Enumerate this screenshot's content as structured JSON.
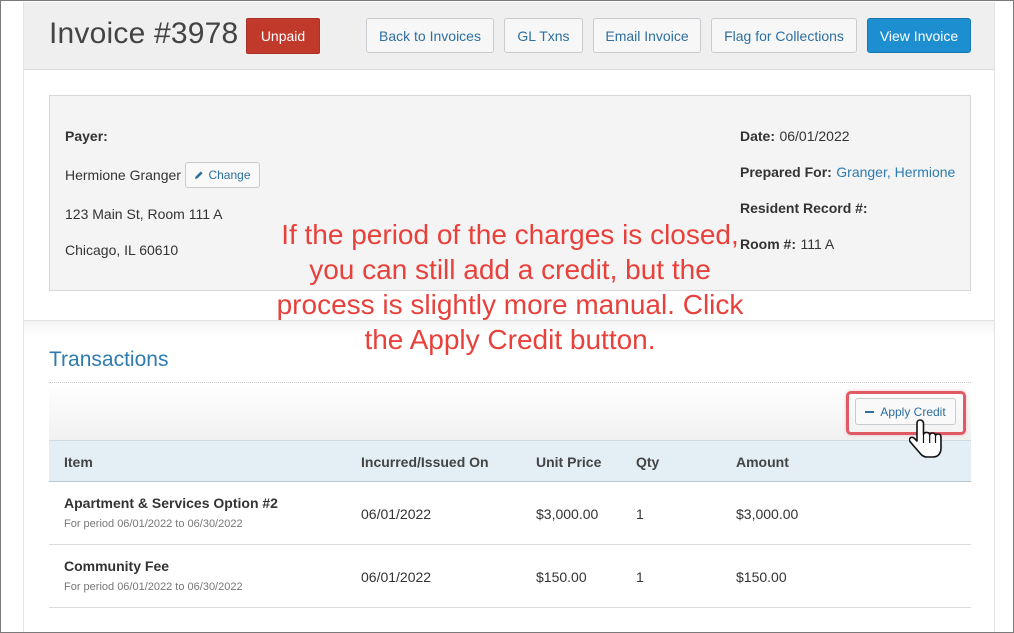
{
  "header": {
    "title": "Invoice #3978",
    "status_badge": "Unpaid",
    "buttons": [
      "Back to Invoices",
      "GL Txns",
      "Email Invoice",
      "Flag for Collections",
      "View Invoice"
    ]
  },
  "info": {
    "payer_label": "Payer:",
    "payer_name": "Hermione Granger",
    "change_label": "Change",
    "address_line1": "123 Main St, Room 111 A",
    "address_line2": "Chicago, IL 60610",
    "date_label": "Date:",
    "date_value": "06/01/2022",
    "prepared_label": "Prepared For:",
    "prepared_value": "Granger, Hermione",
    "resident_label": "Resident Record #:",
    "room_label": "Room #:",
    "room_value": "111 A"
  },
  "annotation": {
    "text": "If the period of the charges is closed, you can still add a credit, but the process is slightly more manual. Click the Apply Credit button."
  },
  "transactions": {
    "title": "Transactions",
    "apply_credit_label": "Apply Credit",
    "columns": [
      "Item",
      "Incurred/Issued On",
      "Unit Price",
      "Qty",
      "Amount"
    ],
    "rows": [
      {
        "item": "Apartment & Services Option #2",
        "period": "For period 06/01/2022 to 06/30/2022",
        "incurred": "06/01/2022",
        "unit_price": "$3,000.00",
        "qty": "1",
        "amount": "$3,000.00"
      },
      {
        "item": "Community Fee",
        "period": "For period 06/01/2022 to 06/30/2022",
        "incurred": "06/01/2022",
        "unit_price": "$150.00",
        "qty": "1",
        "amount": "$150.00"
      }
    ]
  },
  "icons": {
    "change": "pencil-icon",
    "apply_credit": "minus-icon",
    "pointer": "hand-pointer-cursor-icon"
  },
  "colors": {
    "unpaid": "#c0392b",
    "primary_button": "#1d8fd1",
    "link": "#2e7bb0",
    "annotation": "#e8413b",
    "highlight": "#e05a63"
  }
}
